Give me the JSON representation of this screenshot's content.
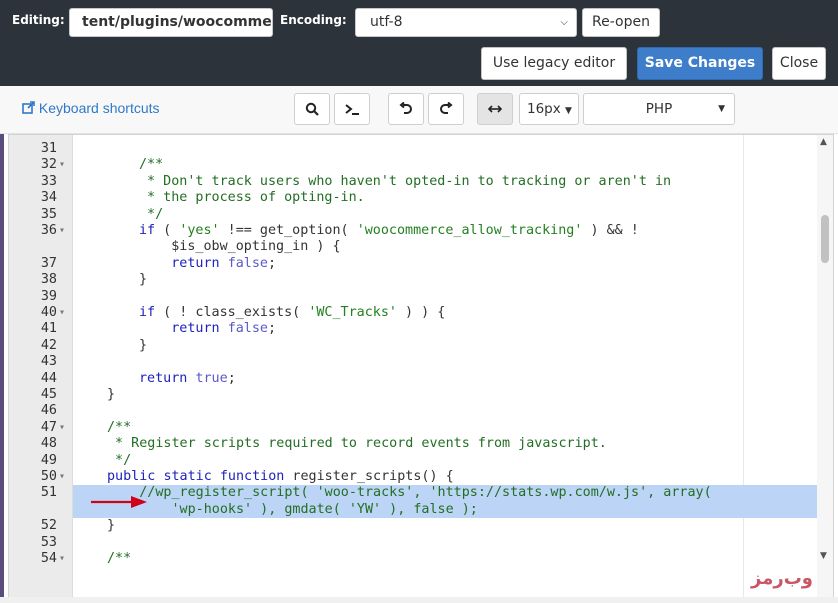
{
  "header": {
    "editing_label": "Editing:",
    "file_path": "tent/plugins/woocomme",
    "encoding_label": "Encoding:",
    "encoding_value": "utf-8",
    "reopen_label": "Re-open",
    "legacy_label": "Use legacy editor",
    "save_label": "Save Changes",
    "close_label": "Close"
  },
  "toolbar": {
    "keyboard_shortcuts": "Keyboard shortcuts",
    "font_size": "16px",
    "language": "PHP",
    "icons": [
      "search-icon",
      "terminal-icon",
      "undo-icon",
      "redo-icon",
      "wrap-icon"
    ]
  },
  "editor": {
    "lines": [
      {
        "n": "31",
        "fold": false,
        "code": ""
      },
      {
        "n": "32",
        "fold": true,
        "code": "/**"
      },
      {
        "n": "33",
        "fold": false,
        "code": " * Don't track users who haven't opted-in to tracking or aren't in"
      },
      {
        "n": "34",
        "fold": false,
        "code": " * the process of opting-in."
      },
      {
        "n": "35",
        "fold": false,
        "code": " */"
      },
      {
        "n": "36",
        "fold": true,
        "code": "if ( 'yes' !== get_option( 'woocommerce_allow_tracking' ) && !"
      },
      {
        "n": "",
        "fold": false,
        "code": "    $is_obw_opting_in ) {"
      },
      {
        "n": "37",
        "fold": false,
        "code": "    return false;"
      },
      {
        "n": "38",
        "fold": false,
        "code": "}"
      },
      {
        "n": "39",
        "fold": false,
        "code": ""
      },
      {
        "n": "40",
        "fold": true,
        "code": "if ( ! class_exists( 'WC_Tracks' ) ) {"
      },
      {
        "n": "41",
        "fold": false,
        "code": "    return false;"
      },
      {
        "n": "42",
        "fold": false,
        "code": "}"
      },
      {
        "n": "43",
        "fold": false,
        "code": ""
      },
      {
        "n": "44",
        "fold": false,
        "code": "return true;"
      },
      {
        "n": "45",
        "fold": false,
        "code": "}"
      },
      {
        "n": "46",
        "fold": false,
        "code": ""
      },
      {
        "n": "47",
        "fold": true,
        "code": "/**"
      },
      {
        "n": "48",
        "fold": false,
        "code": " * Register scripts required to record events from javascript."
      },
      {
        "n": "49",
        "fold": false,
        "code": " */"
      },
      {
        "n": "50",
        "fold": true,
        "code": "public static function register_scripts() {"
      },
      {
        "n": "51",
        "fold": false,
        "code": "    //wp_register_script( 'woo-tracks', 'https://stats.wp.com/w.js', array("
      },
      {
        "n": "",
        "fold": false,
        "code": "        'wp-hooks' ), gmdate( 'YW' ), false );"
      },
      {
        "n": "52",
        "fold": false,
        "code": "}"
      },
      {
        "n": "53",
        "fold": false,
        "code": ""
      },
      {
        "n": "54",
        "fold": true,
        "code": "/**"
      }
    ]
  },
  "watermark": "وب‌رمز",
  "colors": {
    "topbar": "#2d333b",
    "primary": "#3d7dc9",
    "highlight": "#bcd4f6",
    "arrow": "#d0021b"
  }
}
